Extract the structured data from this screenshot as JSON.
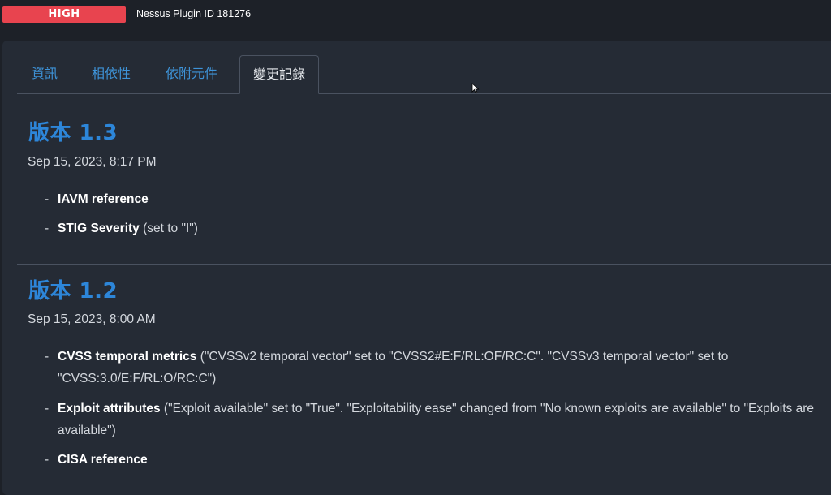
{
  "header": {
    "severity": "HIGH",
    "plugin_id": "Nessus Plugin ID 181276",
    "severity_color": "#e8444f"
  },
  "tabs": [
    {
      "label": "資訊",
      "active": false
    },
    {
      "label": "相依性",
      "active": false
    },
    {
      "label": "依附元件",
      "active": false
    },
    {
      "label": "變更記錄",
      "active": true
    }
  ],
  "versions": [
    {
      "title": "版本 1.3",
      "date": "Sep 15, 2023, 8:17 PM",
      "changes": [
        {
          "dash": "-",
          "name": "IAVM reference",
          "detail": ""
        },
        {
          "dash": "-",
          "name": "STIG Severity",
          "detail": "(set to \"I\")"
        }
      ]
    },
    {
      "title": "版本 1.2",
      "date": "Sep 15, 2023, 8:00 AM",
      "changes": [
        {
          "dash": "-",
          "name": "CVSS temporal metrics",
          "detail": "(\"CVSSv2 temporal vector\" set to \"CVSS2#E:F/RL:OF/RC:C\". \"CVSSv3 temporal vector\" set to \"CVSS:3.0/E:F/RL:O/RC:C\")"
        },
        {
          "dash": "-",
          "name": "Exploit attributes",
          "detail": "(\"Exploit available\" set to \"True\". \"Exploitability ease\" changed from \"No known exploits are available\" to \"Exploits are available\")"
        },
        {
          "dash": "-",
          "name": "CISA reference",
          "detail": ""
        }
      ]
    }
  ],
  "colors": {
    "accent": "#2d86d9",
    "tab_link": "#3e93d8",
    "panel_bg": "#252b35",
    "page_bg": "#1d2128"
  }
}
